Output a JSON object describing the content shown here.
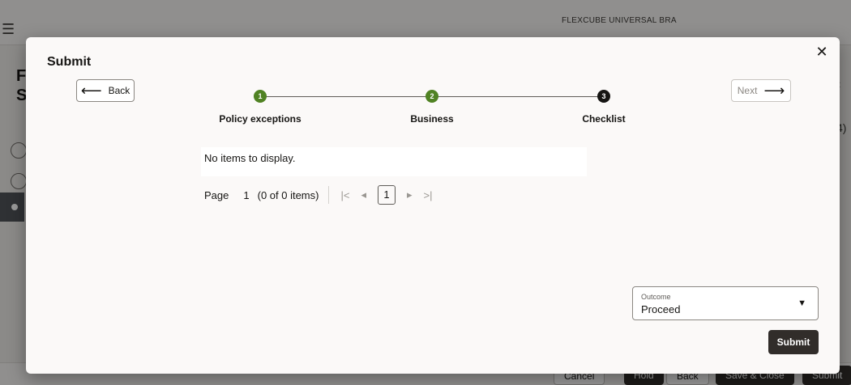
{
  "background": {
    "app_name": "FLEXCUBE UNIVERSAL BRA",
    "footer_buttons": [
      "Cancel",
      "Hold",
      "Back",
      "Save & Close",
      "Submit"
    ],
    "right_count": "4)"
  },
  "dialog": {
    "title": "Submit",
    "back_label": "Back",
    "next_label": "Next",
    "steps": [
      {
        "number": "1",
        "label": "Policy exceptions",
        "status": "done"
      },
      {
        "number": "2",
        "label": "Business",
        "status": "done"
      },
      {
        "number": "3",
        "label": "Checklist",
        "status": "current"
      }
    ],
    "table": {
      "empty_message": "No items to display."
    },
    "pager": {
      "page_label": "Page",
      "page_number": "1",
      "items_info": "(0 of 0 items)",
      "current_page": "1"
    },
    "outcome": {
      "label": "Outcome",
      "value": "Proceed"
    },
    "submit_label": "Submit"
  },
  "colors": {
    "step_done": "#508223",
    "step_current": "#161513",
    "primary_button": "#312d2a"
  }
}
